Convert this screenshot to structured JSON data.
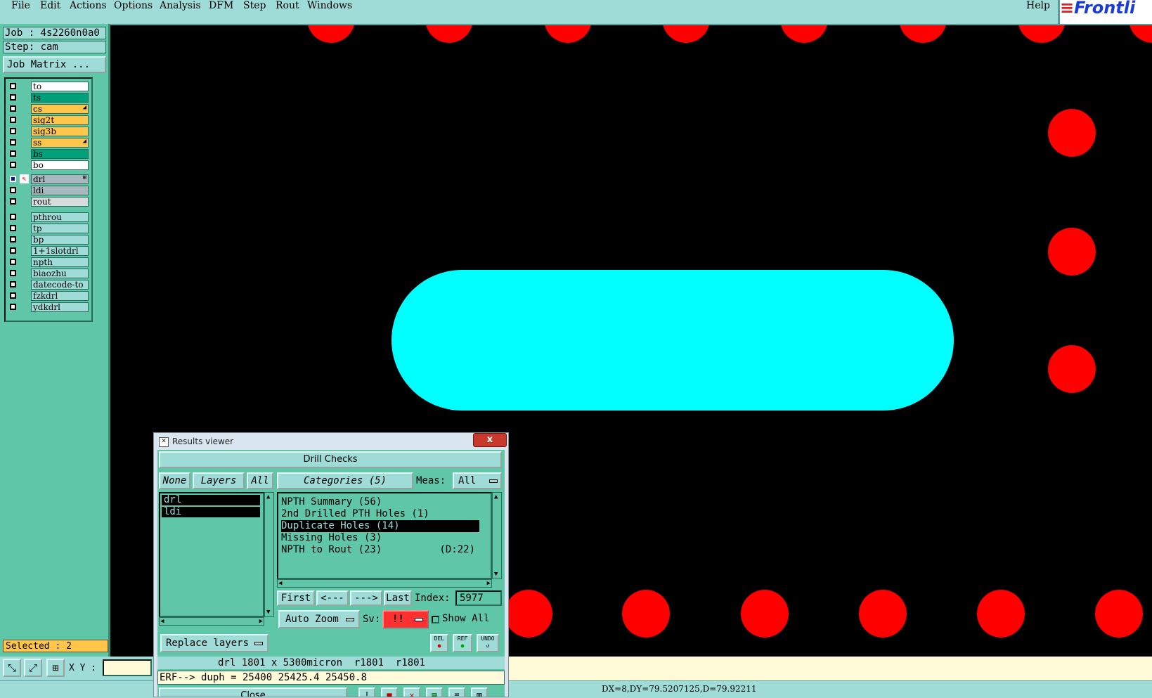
{
  "menubar": {
    "items": [
      "File",
      "Edit",
      "Actions",
      "Options",
      "Analysis",
      "DFM",
      "Step",
      "Rout",
      "Windows"
    ],
    "help": "Help",
    "logo": "Frontli"
  },
  "job": {
    "job_line": "Job : 4s2260n0a0",
    "step_line": "Step: cam",
    "matrix_button": "Job Matrix ..."
  },
  "layers": {
    "group1": [
      {
        "name": "to",
        "color": "#ffffff"
      },
      {
        "name": "ts",
        "color": "#00a07a"
      },
      {
        "name": "cs",
        "color": "#ffc64a",
        "mark": "◢"
      },
      {
        "name": "sig2t",
        "color": "#ffc64a"
      },
      {
        "name": "sig3b",
        "color": "#ffc64a"
      },
      {
        "name": "ss",
        "color": "#ffc64a",
        "mark": "◢"
      },
      {
        "name": "bs",
        "color": "#00a07a"
      },
      {
        "name": "bo",
        "color": "#ffffff"
      }
    ],
    "group2": [
      {
        "name": "drl",
        "color": "#a7b8be",
        "mark": "⊞"
      },
      {
        "name": "ldi",
        "color": "#a7b8be"
      },
      {
        "name": "rout",
        "color": "#d8dcdc"
      }
    ],
    "group3": [
      {
        "name": "pthrou",
        "color": "#9fdcd8"
      },
      {
        "name": "tp",
        "color": "#9fdcd8"
      },
      {
        "name": "bp",
        "color": "#9fdcd8"
      },
      {
        "name": "1+1slotdrl",
        "color": "#9fdcd8"
      },
      {
        "name": "npth",
        "color": "#9fdcd8"
      },
      {
        "name": "biaozhu",
        "color": "#9fdcd8"
      },
      {
        "name": "datecode-to",
        "color": "#9fdcd8"
      },
      {
        "name": "fzkdrl",
        "color": "#9fdcd8"
      },
      {
        "name": "ydkdrl",
        "color": "#9fdcd8"
      }
    ]
  },
  "selected_text": "Selected : 2",
  "toolbar": {
    "xy_label": "X Y :",
    "icons": [
      "zoom-box-icon",
      "zoom-diagonal-icon",
      "grid-snap-icon"
    ]
  },
  "status": {
    "measure": "DX=8,DY=79.5207125,D=79.92211"
  },
  "results_viewer": {
    "title": "Results viewer",
    "close_x": "x",
    "header": "Drill Checks",
    "none_btn": "None",
    "layers_btn": "Layers",
    "all_btn": "All",
    "categories_btn": "Categories (5)",
    "meas_label": "Meas:",
    "meas_value": "All",
    "layer_list": [
      "drl",
      "ldi"
    ],
    "categories": [
      {
        "label": "NPTH Summary (56)",
        "extra": "",
        "selected": false
      },
      {
        "label": "2nd Drilled PTH Holes (1)",
        "extra": "",
        "selected": false
      },
      {
        "label": "Duplicate Holes (14)",
        "extra": "",
        "selected": true
      },
      {
        "label": "Missing Holes (3)",
        "extra": "",
        "selected": false
      },
      {
        "label": "NPTH to Rout (23)",
        "extra": "(D:22)",
        "selected": false
      }
    ],
    "nav": {
      "first": "First",
      "prev": "<---",
      "next": "--->",
      "last": "Last",
      "index_label": "Index:",
      "index_value": "5977"
    },
    "auto_zoom": "Auto Zoom",
    "sv_label": "Sv:",
    "sv_value": "!!",
    "show_all": "Show All",
    "replace_layers": "Replace layers",
    "tool_icons": [
      "DEL",
      "REF",
      "UNDO"
    ],
    "info_line": "drl 1801 x 5300micron  r1801  r1801",
    "erf_line": "ERF--> duph = 25400 25425.4 25450.8",
    "close_btn": "Close"
  },
  "colors": {
    "panel": "#5fc6a8",
    "light": "#9fdcd8",
    "pad": "#ff0000",
    "slot": "#00ffff",
    "highlight": "#ffc64a"
  }
}
